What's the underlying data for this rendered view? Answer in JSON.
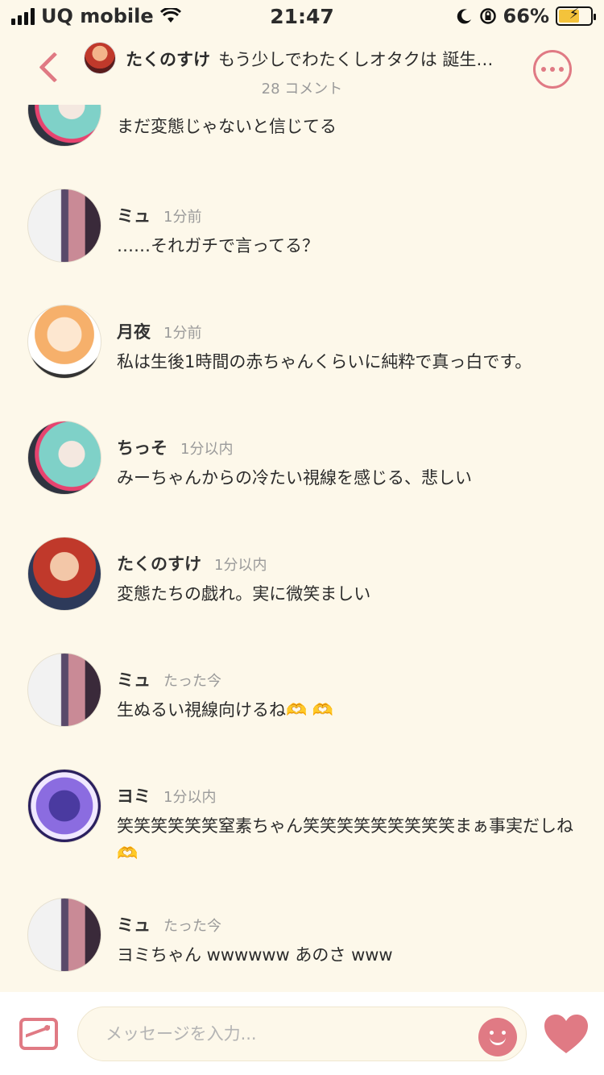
{
  "status_bar": {
    "carrier": "UQ mobile",
    "time": "21:47",
    "battery": "66%",
    "battery_level": 0.66
  },
  "header": {
    "author": "たくのすけ",
    "title": "もう少しでわたくしオタクは 誕生…",
    "comment_count": "28 コメント"
  },
  "comments": [
    {
      "name": "",
      "time": "",
      "text": "まだ変態じゃないと信じてる",
      "avatar": "mint-hair-avatar"
    },
    {
      "name": "ミュ",
      "time": "1分前",
      "text": "……それガチで言ってる？",
      "avatar": "monochrome-avatar"
    },
    {
      "name": "月夜",
      "time": "1分前",
      "text": "私は生後1時間の赤ちゃんくらいに純粋で真っ白です。",
      "avatar": "orange-hair-avatar"
    },
    {
      "name": "ちっそ",
      "time": "1分以内",
      "text": "みーちゃんからの冷たい視線を感じる、悲しい",
      "avatar": "mint-hair-avatar"
    },
    {
      "name": "たくのすけ",
      "time": "1分以内",
      "text": "変態たちの戯れ。実に微笑ましい",
      "avatar": "red-hair-avatar"
    },
    {
      "name": "ミュ",
      "time": "たった今",
      "text": "生ぬるい視線向けるね🫶 🫶",
      "avatar": "monochrome-avatar"
    },
    {
      "name": "ヨミ",
      "time": "1分以内",
      "text": "笑笑笑笑笑笑窒素ちゃん笑笑笑笑笑笑笑笑笑まぁ事実だしね🫶",
      "avatar": "purple-avatar"
    },
    {
      "name": "ミュ",
      "time": "たった今",
      "text": "ヨミちゃん wwwwww あのさ www",
      "avatar": "monochrome-avatar"
    }
  ],
  "input": {
    "placeholder": "メッセージを入力..."
  },
  "colors": {
    "background": "#fdf8ea",
    "accent": "#e07a84"
  }
}
